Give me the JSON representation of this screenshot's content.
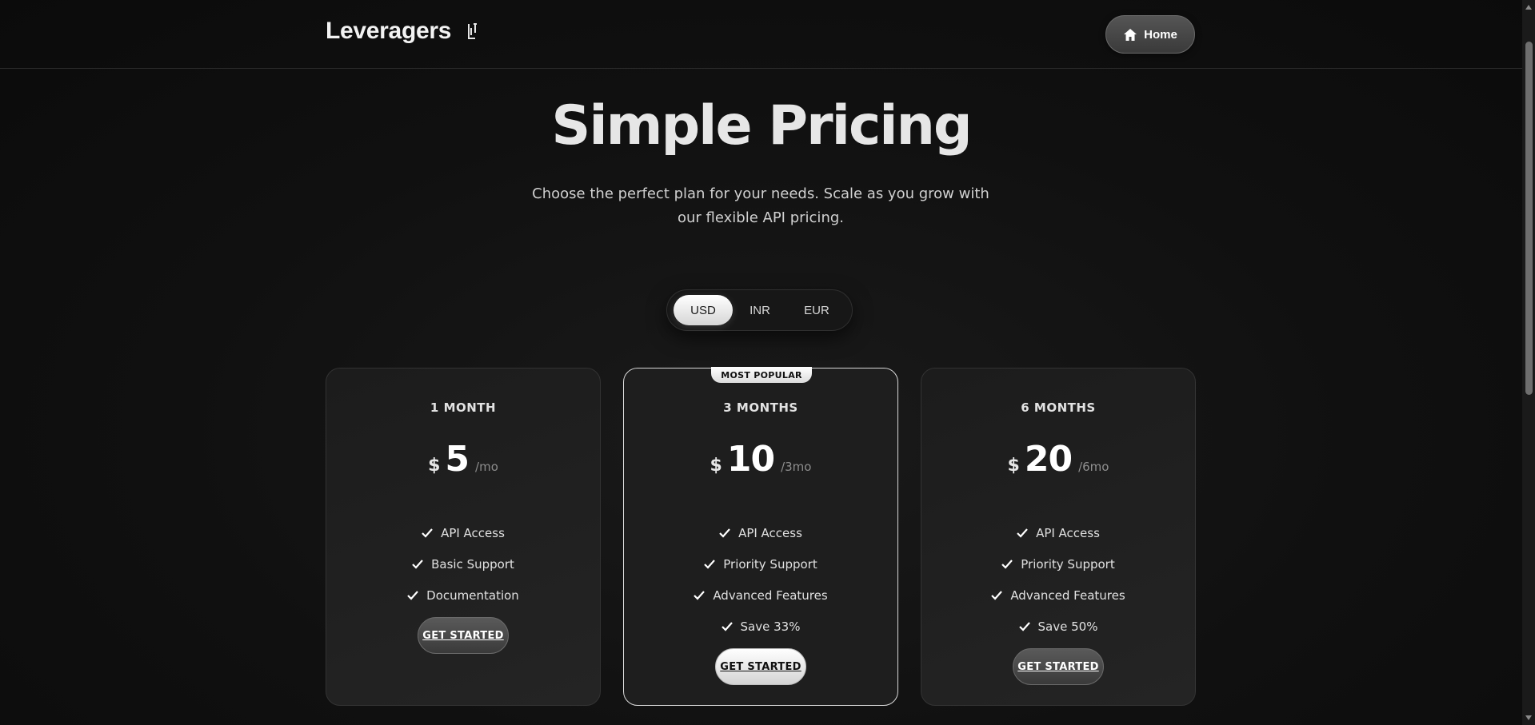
{
  "header": {
    "brand": "Leveragers",
    "home_label": "Home"
  },
  "hero": {
    "title": "Simple Pricing",
    "subtitle": "Choose the perfect plan for your needs. Scale as you grow with our flexible API pricing."
  },
  "currency": {
    "options": [
      "USD",
      "INR",
      "EUR"
    ],
    "selected": "USD"
  },
  "plans": [
    {
      "name": "1 MONTH",
      "currency_symbol": "$",
      "price": "5",
      "period": "/mo",
      "features": [
        "API Access",
        "Basic Support",
        "Documentation"
      ],
      "cta": "GET STARTED"
    },
    {
      "name": "3 MONTHS",
      "badge": "MOST POPULAR",
      "currency_symbol": "$",
      "price": "10",
      "period": "/3mo",
      "features": [
        "API Access",
        "Priority Support",
        "Advanced Features",
        "Save 33%"
      ],
      "cta": "GET STARTED"
    },
    {
      "name": "6 MONTHS",
      "currency_symbol": "$",
      "price": "20",
      "period": "/6mo",
      "features": [
        "API Access",
        "Priority Support",
        "Advanced Features",
        "Save 50%"
      ],
      "cta": "GET STARTED"
    }
  ],
  "colors": {
    "background": "#0d0d0d",
    "card": "#222222",
    "accent_light": "#ffffff"
  },
  "icons": {
    "brand": "brand-mark-icon",
    "home": "home-icon",
    "check": "check-icon"
  }
}
